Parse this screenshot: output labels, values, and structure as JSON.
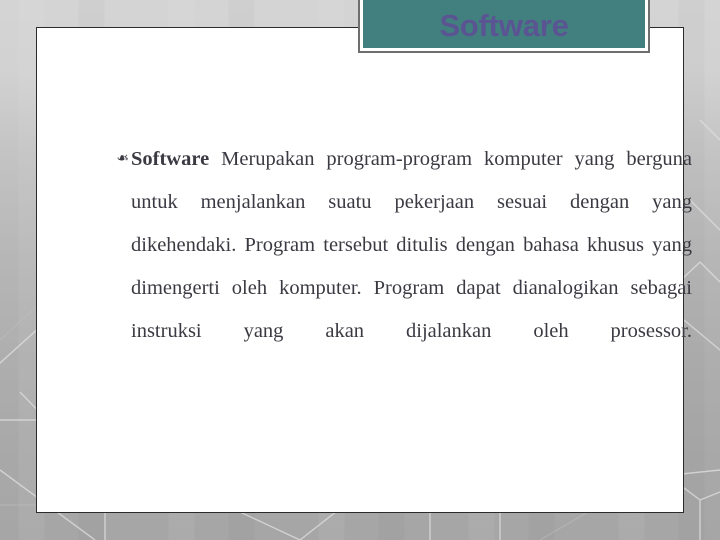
{
  "slide": {
    "title": "Software",
    "title_bg_color": "#42807f",
    "title_text_color": "#5b5493",
    "frame_border_color": "#2b2b2b",
    "background_color": "#b6b6b6",
    "body_text_color": "#3a3a42"
  },
  "body": {
    "bullet_glyph": "❧",
    "bullet_name": "floral-heart-bullet",
    "lead_word": "Software",
    "text": " Merupakan program-program komputer yang berguna untuk menjalankan suatu pekerjaan sesuai dengan yang dikehendaki. Program tersebut ditulis dengan bahasa khusus yang dimengerti oleh komputer. Program dapat dianalogikan sebagai instruksi yang akan dijalankan oleh prosessor."
  }
}
